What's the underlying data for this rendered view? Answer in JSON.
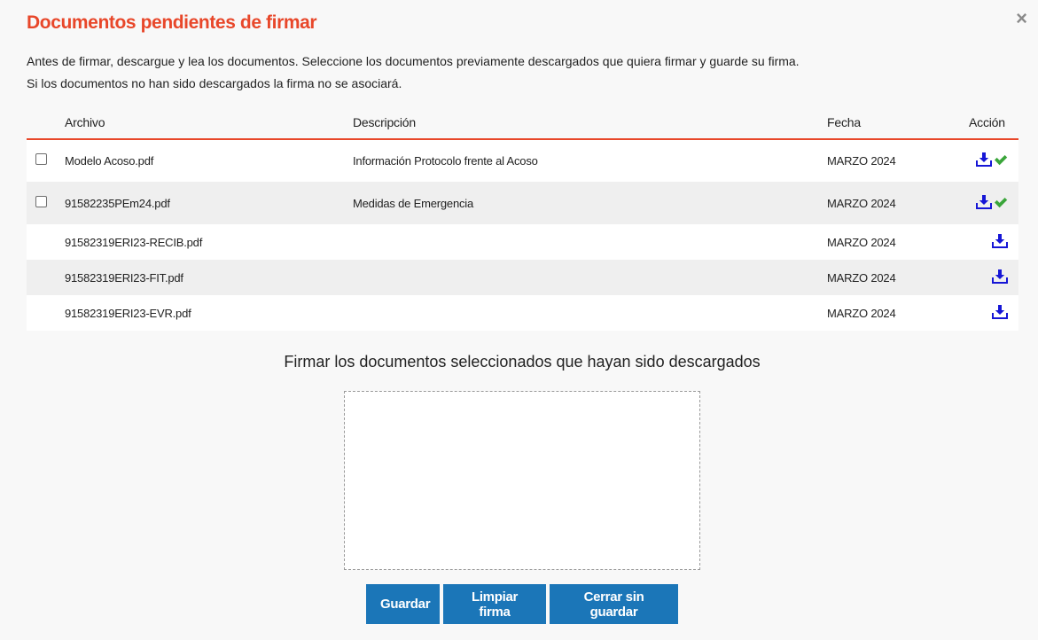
{
  "dialog": {
    "title": "Documentos pendientes de firmar",
    "close_icon": "×",
    "intro_line1": "Antes de firmar, descargue y lea los documentos. Seleccione los documentos previamente descargados que quiera firmar y guarde su firma.",
    "intro_line2": "Si los documentos no han sido descargados la firma no se asociará."
  },
  "table": {
    "headers": {
      "archivo": "Archivo",
      "descripcion": "Descripción",
      "fecha": "Fecha",
      "accion": "Acción"
    },
    "rows": [
      {
        "file": "Modelo Acoso.pdf",
        "description": "Información Protocolo frente al Acoso",
        "date": "MARZO 2024",
        "has_checkbox": true,
        "downloaded": true
      },
      {
        "file": "91582235PEm24.pdf",
        "description": "Medidas de Emergencia",
        "date": "MARZO 2024",
        "has_checkbox": true,
        "downloaded": true
      },
      {
        "file": "91582319ERI23-RECIB.pdf",
        "description": "",
        "date": "MARZO 2024",
        "has_checkbox": false,
        "downloaded": false
      },
      {
        "file": "91582319ERI23-FIT.pdf",
        "description": "",
        "date": "MARZO 2024",
        "has_checkbox": false,
        "downloaded": false
      },
      {
        "file": "91582319ERI23-EVR.pdf",
        "description": "",
        "date": "MARZO 2024",
        "has_checkbox": false,
        "downloaded": false
      }
    ]
  },
  "signature": {
    "label": "Firmar los documentos seleccionados que hayan sido descargados"
  },
  "buttons": {
    "save": "Guardar",
    "clear": "Limpiar firma",
    "close_without_saving": "Cerrar sin guardar"
  },
  "colors": {
    "accent": "#e8472a",
    "button": "#1b76b8",
    "download_icon": "#1616d6",
    "check_icon": "#3aa53a"
  },
  "icons": {
    "download": "download-icon",
    "check": "checkmark-icon",
    "close": "close-icon"
  }
}
